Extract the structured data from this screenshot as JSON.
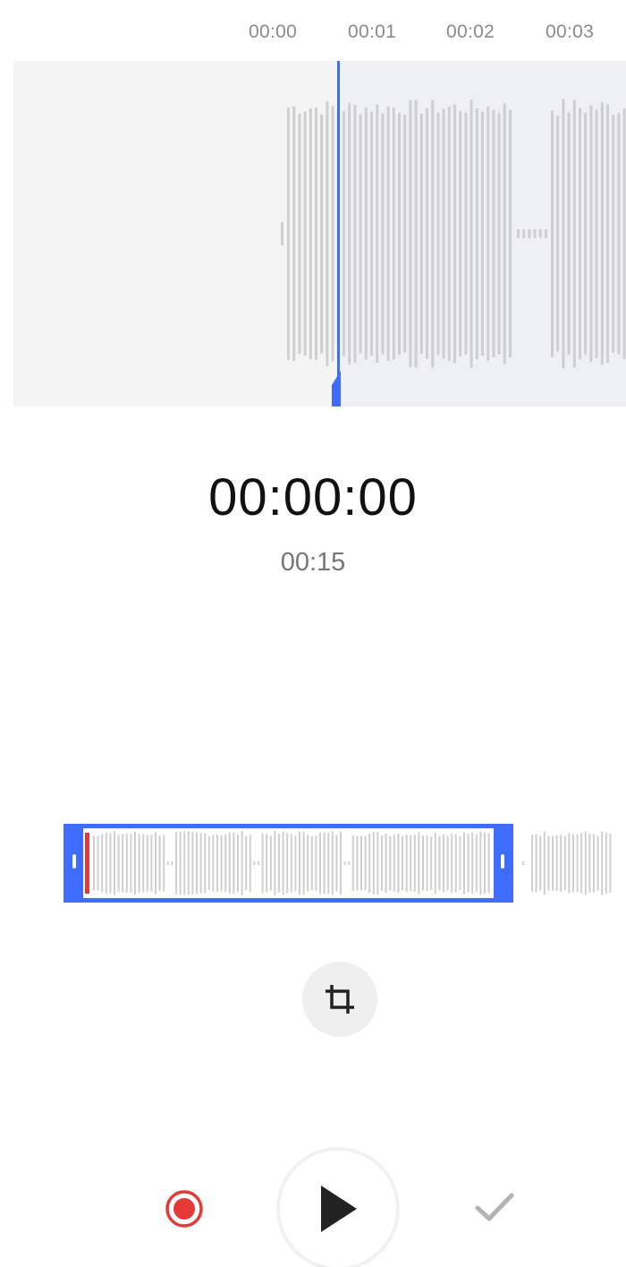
{
  "ruler": {
    "ticks": [
      "00:00",
      "00:01",
      "00:02",
      "00:03"
    ]
  },
  "player": {
    "current_time": "00:00:00",
    "total_duration": "00:15"
  },
  "tools": {
    "crop": {
      "icon": "crop-icon",
      "label": ""
    }
  },
  "controls": {
    "record_icon": "record-icon",
    "play_icon": "play-icon",
    "confirm_icon": "check-icon"
  },
  "colors": {
    "accent": "#3d6cff",
    "record": "#e53935",
    "wave": "#cfcfcf",
    "waveform_bg": "#f4f4f4"
  }
}
